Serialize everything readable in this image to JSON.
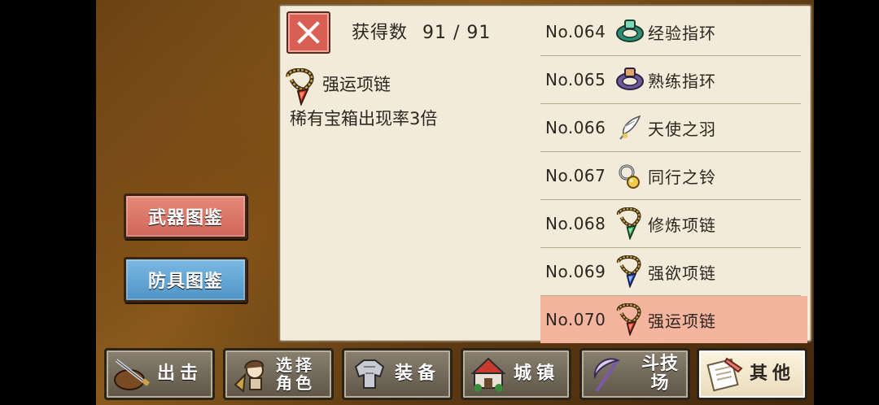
{
  "panel": {
    "count_label": "获得数",
    "count_value": "91 / 91",
    "selected": {
      "name": "强运项链",
      "description": "稀有宝箱出现率3倍"
    }
  },
  "side_buttons": {
    "weapons": "武器图鉴",
    "armor": "防具图鉴"
  },
  "items": [
    {
      "no": "No.064",
      "name": "经验指环",
      "icon": "green-ring-icon"
    },
    {
      "no": "No.065",
      "name": "熟练指环",
      "icon": "purple-ring-icon"
    },
    {
      "no": "No.066",
      "name": "天使之羽",
      "icon": "feather-icon"
    },
    {
      "no": "No.067",
      "name": "同行之铃",
      "icon": "bell-icon"
    },
    {
      "no": "No.068",
      "name": "修炼项链",
      "icon": "green-necklace-icon"
    },
    {
      "no": "No.069",
      "name": "强欲项链",
      "icon": "blue-necklace-icon"
    },
    {
      "no": "No.070",
      "name": "强运项链",
      "icon": "red-necklace-icon",
      "selected": true
    }
  ],
  "tabs": {
    "sortie": "出击",
    "char_line1": "选择",
    "char_line2": "角色",
    "equip": "装备",
    "town": "城镇",
    "arena": "斗技场",
    "other": "其他"
  },
  "colors": {
    "panel_bg": "#f3ebd9",
    "selected_row": "#f4b49e",
    "close_button": "#d95f52",
    "weapon_button": "#cf6558",
    "armor_button": "#4f93c7"
  }
}
